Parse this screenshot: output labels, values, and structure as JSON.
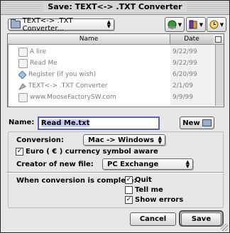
{
  "window": {
    "title": "Save: TEXT<-> .TXT Converter"
  },
  "toolbar": {
    "folder_popup": "TEXT<-> .TXT Converter...",
    "buttons": [
      {
        "icon": "network-globe-icon"
      },
      {
        "icon": "shortcuts-icon"
      },
      {
        "icon": "recent-clock-icon"
      }
    ]
  },
  "file_list": {
    "columns": [
      "Name",
      "Date Modified"
    ],
    "rows": [
      {
        "name": "A lire",
        "date": "9/22/99",
        "icon": "document-icon"
      },
      {
        "name": "Read Me",
        "date": "9/22/99",
        "icon": "document-icon"
      },
      {
        "name": "Register (if you wish)",
        "date": "6/20/99",
        "icon": "register-icon"
      },
      {
        "name": "TEXT<-> .TXT Converter",
        "date": "2/1/09",
        "icon": "application-icon"
      },
      {
        "name": "www.MooseFactorySW.com",
        "date": "9/9/99",
        "icon": "url-icon"
      }
    ]
  },
  "name_field": {
    "label": "Name:",
    "value": "Read Me.txt"
  },
  "new_button": {
    "label": "New"
  },
  "options": {
    "conversion_label": "Conversion:",
    "conversion_value": "Mac -> Windows",
    "euro_label": "Euro ( € ) currency symbol aware",
    "euro_checked": true,
    "creator_label": "Creator of new file:",
    "creator_value": "PC Exchange",
    "complete_label": "When conversion is complete:",
    "quit_label": "Quit",
    "quit_checked": true,
    "tell_label": "Tell me",
    "tell_checked": false,
    "errors_label": "Show errors",
    "errors_checked": true
  },
  "buttons": {
    "cancel": "Cancel",
    "save": "Save"
  },
  "colors": {
    "accent": "#5562c8",
    "window_bg": "#e7e7e7"
  }
}
